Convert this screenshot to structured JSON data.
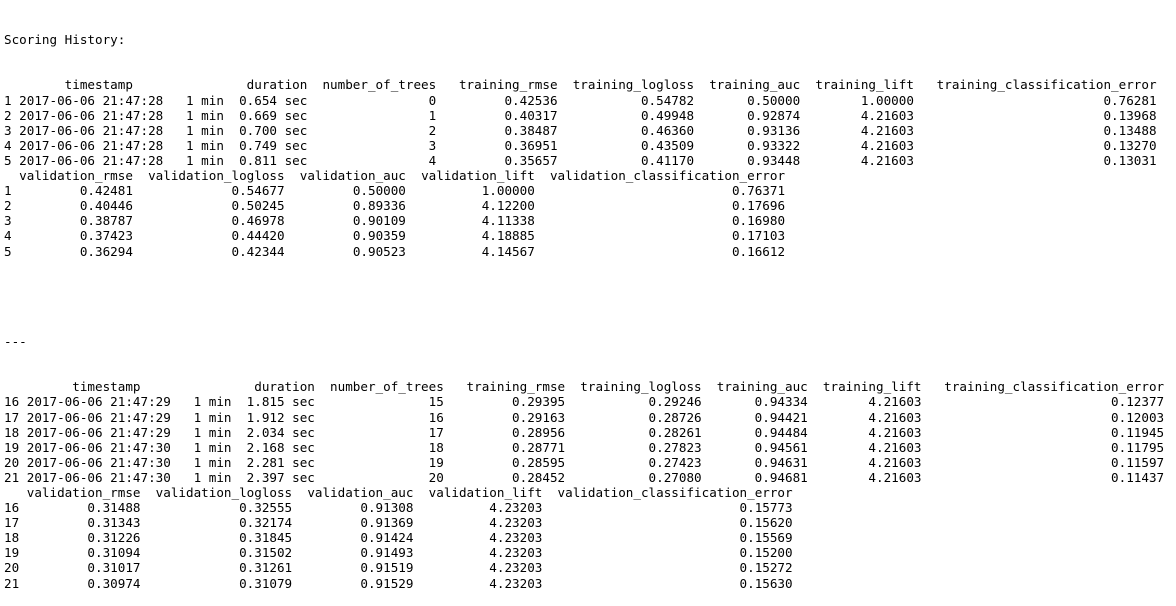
{
  "console": {
    "heading": "Scoring History:",
    "separator": "---",
    "training_columns": [
      "",
      "timestamp",
      "duration",
      "number_of_trees",
      "training_rmse",
      "training_logloss",
      "training_auc",
      "training_lift",
      "training_classification_error"
    ],
    "validation_columns": [
      "",
      "validation_rmse",
      "validation_logloss",
      "validation_auc",
      "validation_lift",
      "validation_classification_error"
    ],
    "blocks": [
      {
        "training_rows": [
          [
            "1",
            "2017-06-06 21:47:28",
            "1 min",
            "0.654 sec",
            "0",
            "0.42536",
            "0.54782",
            "0.50000",
            "1.00000",
            "0.76281"
          ],
          [
            "2",
            "2017-06-06 21:47:28",
            "1 min",
            "0.669 sec",
            "1",
            "0.40317",
            "0.49948",
            "0.92874",
            "4.21603",
            "0.13968"
          ],
          [
            "3",
            "2017-06-06 21:47:28",
            "1 min",
            "0.700 sec",
            "2",
            "0.38487",
            "0.46360",
            "0.93136",
            "4.21603",
            "0.13488"
          ],
          [
            "4",
            "2017-06-06 21:47:28",
            "1 min",
            "0.749 sec",
            "3",
            "0.36951",
            "0.43509",
            "0.93322",
            "4.21603",
            "0.13270"
          ],
          [
            "5",
            "2017-06-06 21:47:28",
            "1 min",
            "0.811 sec",
            "4",
            "0.35657",
            "0.41170",
            "0.93448",
            "4.21603",
            "0.13031"
          ]
        ],
        "validation_rows": [
          [
            "1",
            "0.42481",
            "0.54677",
            "0.50000",
            "1.00000",
            "0.76371"
          ],
          [
            "2",
            "0.40446",
            "0.50245",
            "0.89336",
            "4.12200",
            "0.17696"
          ],
          [
            "3",
            "0.38787",
            "0.46978",
            "0.90109",
            "4.11338",
            "0.16980"
          ],
          [
            "4",
            "0.37423",
            "0.44420",
            "0.90359",
            "4.18885",
            "0.17103"
          ],
          [
            "5",
            "0.36294",
            "0.42344",
            "0.90523",
            "4.14567",
            "0.16612"
          ]
        ]
      },
      {
        "training_rows": [
          [
            "16",
            "2017-06-06 21:47:29",
            "1 min",
            "1.815 sec",
            "15",
            "0.29395",
            "0.29246",
            "0.94334",
            "4.21603",
            "0.12377"
          ],
          [
            "17",
            "2017-06-06 21:47:29",
            "1 min",
            "1.912 sec",
            "16",
            "0.29163",
            "0.28726",
            "0.94421",
            "4.21603",
            "0.12003"
          ],
          [
            "18",
            "2017-06-06 21:47:29",
            "1 min",
            "2.034 sec",
            "17",
            "0.28956",
            "0.28261",
            "0.94484",
            "4.21603",
            "0.11945"
          ],
          [
            "19",
            "2017-06-06 21:47:30",
            "1 min",
            "2.168 sec",
            "18",
            "0.28771",
            "0.27823",
            "0.94561",
            "4.21603",
            "0.11795"
          ],
          [
            "20",
            "2017-06-06 21:47:30",
            "1 min",
            "2.281 sec",
            "19",
            "0.28595",
            "0.27423",
            "0.94631",
            "4.21603",
            "0.11597"
          ],
          [
            "21",
            "2017-06-06 21:47:30",
            "1 min",
            "2.397 sec",
            "20",
            "0.28452",
            "0.27080",
            "0.94681",
            "4.21603",
            "0.11437"
          ]
        ],
        "validation_rows": [
          [
            "16",
            "0.31488",
            "0.32555",
            "0.91308",
            "4.23203",
            "0.15773"
          ],
          [
            "17",
            "0.31343",
            "0.32174",
            "0.91369",
            "4.23203",
            "0.15620"
          ],
          [
            "18",
            "0.31226",
            "0.31845",
            "0.91424",
            "4.23203",
            "0.15569"
          ],
          [
            "19",
            "0.31094",
            "0.31502",
            "0.91493",
            "4.23203",
            "0.15200"
          ],
          [
            "20",
            "0.31017",
            "0.31261",
            "0.91519",
            "4.23203",
            "0.15272"
          ],
          [
            "21",
            "0.30974",
            "0.31079",
            "0.91529",
            "4.23203",
            "0.15630"
          ]
        ]
      }
    ]
  }
}
